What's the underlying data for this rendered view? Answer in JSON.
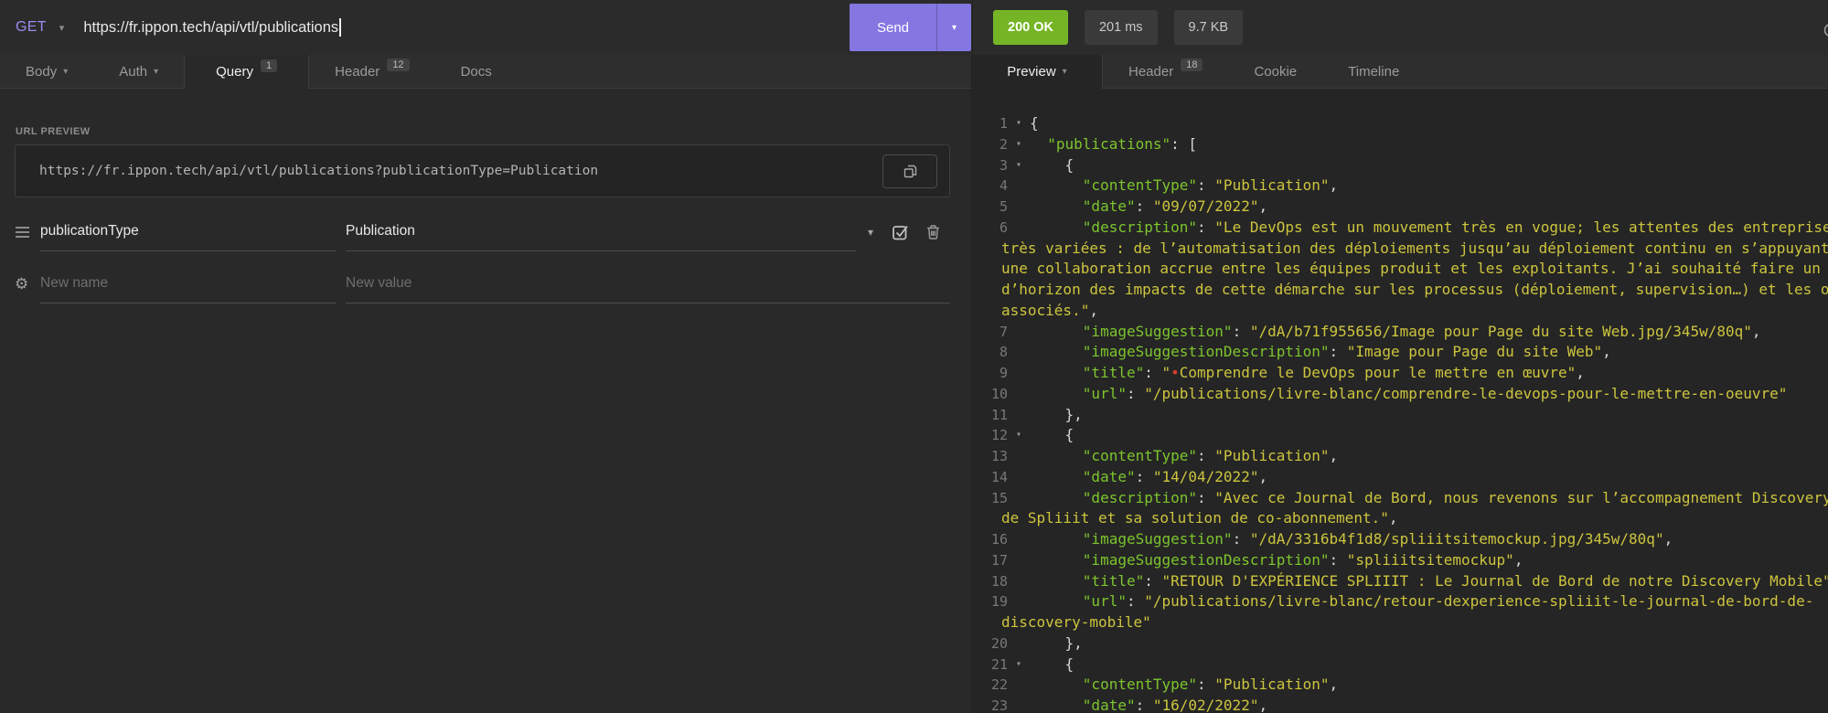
{
  "request_bar": {
    "method": "GET",
    "url": "https://fr.ippon.tech/api/vtl/publications",
    "send_label": "Send"
  },
  "response_meta": {
    "status": "200 OK",
    "time": "201 ms",
    "size": "9.7 KB"
  },
  "request_tabs": [
    {
      "label": "Body"
    },
    {
      "label": "Auth"
    },
    {
      "label": "Query",
      "badge": "1",
      "active": true
    },
    {
      "label": "Header",
      "badge": "12"
    },
    {
      "label": "Docs"
    }
  ],
  "response_tabs": [
    {
      "label": "Preview",
      "active": true
    },
    {
      "label": "Header",
      "badge": "18"
    },
    {
      "label": "Cookie"
    },
    {
      "label": "Timeline"
    }
  ],
  "url_preview": {
    "label": "URL PREVIEW",
    "value": "https://fr.ippon.tech/api/vtl/publications?publicationType=Publication"
  },
  "params": {
    "rows": [
      {
        "name": "publicationType",
        "value": "Publication"
      }
    ],
    "new_row": {
      "name_placeholder": "New name",
      "value_placeholder": "New value"
    }
  },
  "colors": {
    "accent_purple": "#8577e2",
    "method_purple": "#9a8cf0",
    "status_green": "#75b525",
    "json_key_green": "#7dc52e",
    "json_string_yellow": "#cdc53e",
    "marker_red": "#d3412e"
  },
  "response_body": {
    "lines": [
      {
        "n": "1",
        "a": true,
        "segs": [
          [
            "p",
            "{"
          ]
        ]
      },
      {
        "n": "2",
        "a": true,
        "segs": [
          [
            "p",
            "  "
          ],
          [
            "k",
            "\"publications\""
          ],
          [
            "p",
            ": ["
          ]
        ]
      },
      {
        "n": "3",
        "a": true,
        "segs": [
          [
            "p",
            "    {"
          ]
        ]
      },
      {
        "n": "4",
        "segs": [
          [
            "p",
            "      "
          ],
          [
            "k",
            "\"contentType\""
          ],
          [
            "p",
            ": "
          ],
          [
            "s",
            "\"Publication\""
          ],
          [
            "p",
            ","
          ]
        ]
      },
      {
        "n": "5",
        "segs": [
          [
            "p",
            "      "
          ],
          [
            "k",
            "\"date\""
          ],
          [
            "p",
            ": "
          ],
          [
            "s",
            "\"09/07/2022\""
          ],
          [
            "p",
            ","
          ]
        ]
      },
      {
        "n": "6",
        "segs": [
          [
            "p",
            "      "
          ],
          [
            "k",
            "\"description\""
          ],
          [
            "p",
            ": "
          ],
          [
            "s",
            "\"Le DevOps est un mouvement très en vogue; les attentes des entreprises"
          ]
        ]
      },
      {
        "w": true,
        "segs": [
          [
            "s",
            "très variées : de l’automatisation des déploiements jusqu’au déploiement continu en s’appuyant sur"
          ]
        ]
      },
      {
        "w": true,
        "segs": [
          [
            "s",
            "une collaboration accrue entre les équipes produit et les exploitants. J’ai souhaité faire un tour"
          ]
        ]
      },
      {
        "w": true,
        "segs": [
          [
            "s",
            "d’horizon des impacts de cette démarche sur les processus (déploiement, supervision…) et les outils"
          ]
        ]
      },
      {
        "w": true,
        "segs": [
          [
            "s",
            "associés.\""
          ],
          [
            "p",
            ","
          ]
        ]
      },
      {
        "n": "7",
        "segs": [
          [
            "p",
            "      "
          ],
          [
            "k",
            "\"imageSuggestion\""
          ],
          [
            "p",
            ": "
          ],
          [
            "s",
            "\"/dA/b71f955656/Image pour Page du site Web.jpg/345w/80q\""
          ],
          [
            "p",
            ","
          ]
        ]
      },
      {
        "n": "8",
        "segs": [
          [
            "p",
            "      "
          ],
          [
            "k",
            "\"imageSuggestionDescription\""
          ],
          [
            "p",
            ": "
          ],
          [
            "s",
            "\"Image pour Page du site Web\""
          ],
          [
            "p",
            ","
          ]
        ]
      },
      {
        "n": "9",
        "segs": [
          [
            "p",
            "      "
          ],
          [
            "k",
            "\"title\""
          ],
          [
            "p",
            ": "
          ],
          [
            "s",
            "\""
          ],
          [
            "r",
            "•"
          ],
          [
            "s",
            "Comprendre le DevOps pour le mettre en œuvre\""
          ],
          [
            "p",
            ","
          ]
        ]
      },
      {
        "n": "10",
        "segs": [
          [
            "p",
            "      "
          ],
          [
            "k",
            "\"url\""
          ],
          [
            "p",
            ": "
          ],
          [
            "s",
            "\"/publications/livre-blanc/comprendre-le-devops-pour-le-mettre-en-oeuvre\""
          ]
        ]
      },
      {
        "n": "11",
        "segs": [
          [
            "p",
            "    },"
          ]
        ]
      },
      {
        "n": "12",
        "a": true,
        "segs": [
          [
            "p",
            "    {"
          ]
        ]
      },
      {
        "n": "13",
        "segs": [
          [
            "p",
            "      "
          ],
          [
            "k",
            "\"contentType\""
          ],
          [
            "p",
            ": "
          ],
          [
            "s",
            "\"Publication\""
          ],
          [
            "p",
            ","
          ]
        ]
      },
      {
        "n": "14",
        "segs": [
          [
            "p",
            "      "
          ],
          [
            "k",
            "\"date\""
          ],
          [
            "p",
            ": "
          ],
          [
            "s",
            "\"14/04/2022\""
          ],
          [
            "p",
            ","
          ]
        ]
      },
      {
        "n": "15",
        "segs": [
          [
            "p",
            "      "
          ],
          [
            "k",
            "\"description\""
          ],
          [
            "p",
            ": "
          ],
          [
            "s",
            "\"Avec ce Journal de Bord, nous revenons sur l’accompagnement Discovery"
          ]
        ]
      },
      {
        "w": true,
        "segs": [
          [
            "s",
            "de Spliiit et sa solution de co-abonnement.\""
          ],
          [
            "p",
            ","
          ]
        ]
      },
      {
        "n": "16",
        "segs": [
          [
            "p",
            "      "
          ],
          [
            "k",
            "\"imageSuggestion\""
          ],
          [
            "p",
            ": "
          ],
          [
            "s",
            "\"/dA/3316b4f1d8/spliiitsitemockup.jpg/345w/80q\""
          ],
          [
            "p",
            ","
          ]
        ]
      },
      {
        "n": "17",
        "segs": [
          [
            "p",
            "      "
          ],
          [
            "k",
            "\"imageSuggestionDescription\""
          ],
          [
            "p",
            ": "
          ],
          [
            "s",
            "\"spliiitsitemockup\""
          ],
          [
            "p",
            ","
          ]
        ]
      },
      {
        "n": "18",
        "segs": [
          [
            "p",
            "      "
          ],
          [
            "k",
            "\"title\""
          ],
          [
            "p",
            ": "
          ],
          [
            "s",
            "\"RETOUR D'EXPÉRIENCE SPLIIIT : Le Journal de Bord de notre Discovery Mobile\""
          ],
          [
            "p",
            ","
          ]
        ]
      },
      {
        "n": "19",
        "segs": [
          [
            "p",
            "      "
          ],
          [
            "k",
            "\"url\""
          ],
          [
            "p",
            ": "
          ],
          [
            "s",
            "\"/publications/livre-blanc/retour-dexperience-spliiit-le-journal-de-bord-de-"
          ]
        ]
      },
      {
        "w": true,
        "segs": [
          [
            "s",
            "discovery-mobile\""
          ]
        ]
      },
      {
        "n": "20",
        "segs": [
          [
            "p",
            "    },"
          ]
        ]
      },
      {
        "n": "21",
        "a": true,
        "segs": [
          [
            "p",
            "    {"
          ]
        ]
      },
      {
        "n": "22",
        "segs": [
          [
            "p",
            "      "
          ],
          [
            "k",
            "\"contentType\""
          ],
          [
            "p",
            ": "
          ],
          [
            "s",
            "\"Publication\""
          ],
          [
            "p",
            ","
          ]
        ]
      },
      {
        "n": "23",
        "segs": [
          [
            "p",
            "      "
          ],
          [
            "k",
            "\"date\""
          ],
          [
            "p",
            ": "
          ],
          [
            "s",
            "\"16/02/2022\""
          ],
          [
            "p",
            ","
          ]
        ]
      }
    ]
  }
}
